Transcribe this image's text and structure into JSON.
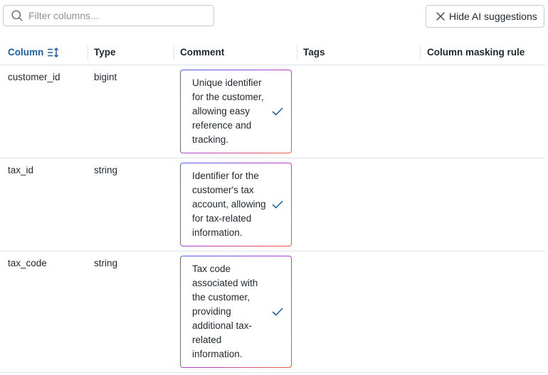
{
  "filter": {
    "placeholder": "Filter columns..."
  },
  "actions": {
    "hide_ai_label": "Hide AI suggestions"
  },
  "table": {
    "headers": {
      "column": "Column",
      "type": "Type",
      "comment": "Comment",
      "tags": "Tags",
      "masking": "Column masking rule"
    },
    "rows": [
      {
        "name": "customer_id",
        "type": "bigint",
        "suggestion": "Unique identifier\nfor the customer,\nallowing easy\nreference and\ntracking."
      },
      {
        "name": "tax_id",
        "type": "string",
        "suggestion": "Identifier for the\ncustomer's tax\naccount, allowing\nfor tax-related\ninformation."
      },
      {
        "name": "tax_code",
        "type": "string",
        "suggestion": "Tax code\nassociated with\nthe customer,\nproviding\nadditional tax-\nrelated\ninformation."
      }
    ]
  },
  "colors": {
    "accent": "#1a5fa8",
    "border": "#dde2e6",
    "ai_gradient": [
      "#4a5ff0",
      "#b23ed0",
      "#ef5a3b"
    ]
  },
  "icons": {
    "filter": "search-icon",
    "hide": "close-icon",
    "sort": "sort-icon",
    "accept": "check-icon"
  }
}
